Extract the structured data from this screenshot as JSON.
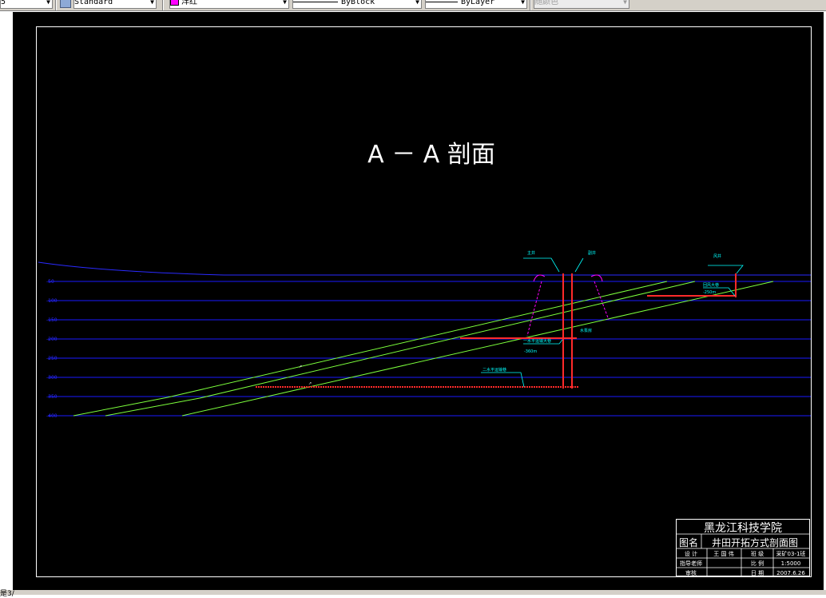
{
  "toolbar": {
    "field0_value": "5",
    "textstyle_value": "Standard",
    "color_value": "洋红",
    "linetype_value": "ByBlock",
    "lineweight_value": "ByLayer",
    "plotstyle_value": "随颜色"
  },
  "drawing": {
    "title": "A － A 剖面",
    "level_labels": [
      "-50",
      "-100",
      "-150",
      "-200",
      "-250",
      "-300",
      "-350",
      "-400"
    ],
    "annotations": {
      "main_shaft": "主井",
      "aux_shaft": "副井",
      "vent_shaft": "风井",
      "level1_road": "一水平运输大巷",
      "level1_depth": "-360m",
      "level2_road": "二水平运输巷",
      "pump_room": "水泵房",
      "vent_road": "回风大巷",
      "vent_depth": "-250m"
    }
  },
  "title_block": {
    "school": "黑龙江科技学院",
    "drawing_name_label": "图名",
    "drawing_name": "井田开拓方式剖面图",
    "designer_label": "设 计",
    "designer": "王 国 伟",
    "class_label": "班 级",
    "class_value": "采矿03-1班",
    "advisor_label": "指导老师",
    "advisor": "",
    "scale_label": "比 例",
    "scale_value": "1:5000",
    "reviewer_label": "审核",
    "reviewer": "",
    "date_label": "日 期",
    "date_value": "2007.6.26"
  },
  "statusbar": {
    "text": "是3/"
  },
  "colors": {
    "accent_red": "#ff2a2a",
    "accent_blue": "#0000ff",
    "accent_green": "#7cff3c",
    "accent_magenta": "#ff00ff",
    "accent_cyan": "#00ffff"
  }
}
